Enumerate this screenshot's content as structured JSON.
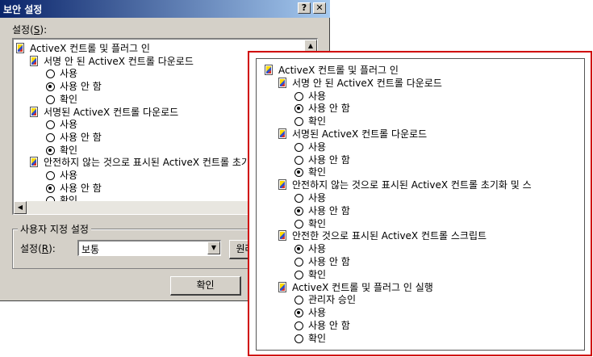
{
  "dialog": {
    "title": "보안 설정",
    "help_button": "?",
    "close_button": "✕",
    "settings_label_prefix": "설정(",
    "settings_label_key": "S",
    "settings_label_suffix": "):",
    "list": [
      {
        "type": "category",
        "label": "ActiveX 컨트롤 및 플러그 인"
      },
      {
        "type": "setting",
        "label": "서명 안 된 ActiveX 컨트롤 다운로드"
      },
      {
        "type": "option",
        "label": "사용",
        "selected": false
      },
      {
        "type": "option",
        "label": "사용 안 함",
        "selected": true
      },
      {
        "type": "option",
        "label": "확인",
        "selected": false
      },
      {
        "type": "setting",
        "label": "서명된 ActiveX 컨트롤 다운로드"
      },
      {
        "type": "option",
        "label": "사용",
        "selected": false
      },
      {
        "type": "option",
        "label": "사용 안 함",
        "selected": false
      },
      {
        "type": "option",
        "label": "확인",
        "selected": true
      },
      {
        "type": "setting",
        "label": "안전하지 않는 것으로 표시된 ActiveX 컨트롤 초기"
      },
      {
        "type": "option",
        "label": "사용",
        "selected": false
      },
      {
        "type": "option",
        "label": "사용 안 함",
        "selected": true
      },
      {
        "type": "option",
        "label": "확인",
        "selected": false
      }
    ],
    "custom_group_title": "사용자 지정 설정",
    "reset_label_prefix": "설정(",
    "reset_label_key": "R",
    "reset_label_suffix": "):",
    "reset_value": "보통",
    "reset_button": "원래",
    "ok_button": "확인"
  },
  "zoom": {
    "list": [
      {
        "type": "category",
        "label": "ActiveX 컨트롤 및 플러그 인"
      },
      {
        "type": "setting",
        "label": "서명 안 된 ActiveX 컨트롤 다운로드"
      },
      {
        "type": "option",
        "label": "사용",
        "selected": false
      },
      {
        "type": "option",
        "label": "사용 안 함",
        "selected": true
      },
      {
        "type": "option",
        "label": "확인",
        "selected": false
      },
      {
        "type": "setting",
        "label": "서명된 ActiveX 컨트롤 다운로드"
      },
      {
        "type": "option",
        "label": "사용",
        "selected": false
      },
      {
        "type": "option",
        "label": "사용 안 함",
        "selected": false
      },
      {
        "type": "option",
        "label": "확인",
        "selected": true
      },
      {
        "type": "setting",
        "label": "안전하지 않는 것으로 표시된 ActiveX 컨트롤 초기화 및 스"
      },
      {
        "type": "option",
        "label": "사용",
        "selected": false
      },
      {
        "type": "option",
        "label": "사용 안 함",
        "selected": true
      },
      {
        "type": "option",
        "label": "확인",
        "selected": false
      },
      {
        "type": "setting",
        "label": "안전한 것으로 표시된 ActiveX 컨트롤 스크립트"
      },
      {
        "type": "option",
        "label": "사용",
        "selected": true
      },
      {
        "type": "option",
        "label": "사용 안 함",
        "selected": false
      },
      {
        "type": "option",
        "label": "확인",
        "selected": false
      },
      {
        "type": "setting",
        "label": "ActiveX 컨트롤 및 플러그 인 실행"
      },
      {
        "type": "option",
        "label": "관리자 승인",
        "selected": false
      },
      {
        "type": "option",
        "label": "사용",
        "selected": true
      },
      {
        "type": "option",
        "label": "사용 안 함",
        "selected": false
      },
      {
        "type": "option",
        "label": "확인",
        "selected": false
      }
    ]
  },
  "colors": {
    "titlebar": "#0a246a",
    "dialog_bg": "#d4d0c8",
    "highlight_border": "#d00000"
  }
}
